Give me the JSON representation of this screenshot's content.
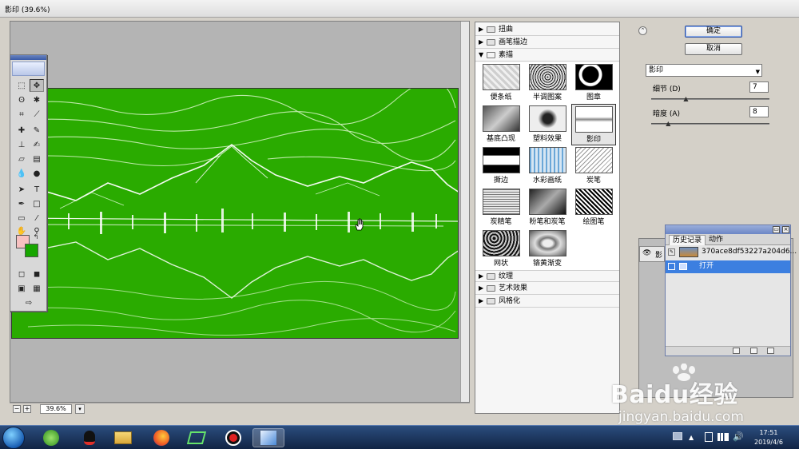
{
  "window": {
    "title": "影印 (39.6%)"
  },
  "preview": {
    "zoom": "39.6%",
    "zoom_out": "−",
    "zoom_in": "+",
    "dropdown": "▾"
  },
  "gallery": {
    "categories_top": [
      {
        "label": "扭曲",
        "expanded": false
      },
      {
        "label": "画笔描边",
        "expanded": false
      },
      {
        "label": "素描",
        "expanded": true
      }
    ],
    "sketch_filters": [
      {
        "label": "便条纸"
      },
      {
        "label": "半调图案"
      },
      {
        "label": "图章"
      },
      {
        "label": "基底凸现"
      },
      {
        "label": "塑料效果"
      },
      {
        "label": "影印",
        "selected": true
      },
      {
        "label": "撕边"
      },
      {
        "label": "水彩画纸"
      },
      {
        "label": "炭笔"
      },
      {
        "label": "炭精笔"
      },
      {
        "label": "粉笔和炭笔"
      },
      {
        "label": "绘图笔"
      },
      {
        "label": "网状"
      },
      {
        "label": "铬黄渐变"
      }
    ],
    "categories_bottom": [
      {
        "label": "纹理",
        "expanded": false
      },
      {
        "label": "艺术效果",
        "expanded": false
      },
      {
        "label": "风格化",
        "expanded": false
      }
    ]
  },
  "settings": {
    "ok_label": "确定",
    "cancel_label": "取消",
    "filter_name": "影印",
    "params": [
      {
        "label": "细节 (D)",
        "value": "7",
        "fraction": 0.3
      },
      {
        "label": "暗度 (A)",
        "value": "8",
        "fraction": 0.15
      }
    ]
  },
  "history": {
    "tabs": [
      "历史记录",
      "动作"
    ],
    "snapshot_label": "370ace8df53227a204d6...",
    "states": [
      {
        "label": "打开",
        "selected": true
      }
    ],
    "layer_tab_fragment": "影"
  },
  "watermark": {
    "big": "Baidu经验",
    "small": "jingyan.baidu.com"
  },
  "taskbar": {
    "time": "17:51",
    "date": "2019/4/6"
  },
  "colors": {
    "canvas_green": "#2aab00",
    "foreground": "#f7c1c1",
    "background": "#17a600",
    "selection_blue": "#3c7fe0"
  }
}
